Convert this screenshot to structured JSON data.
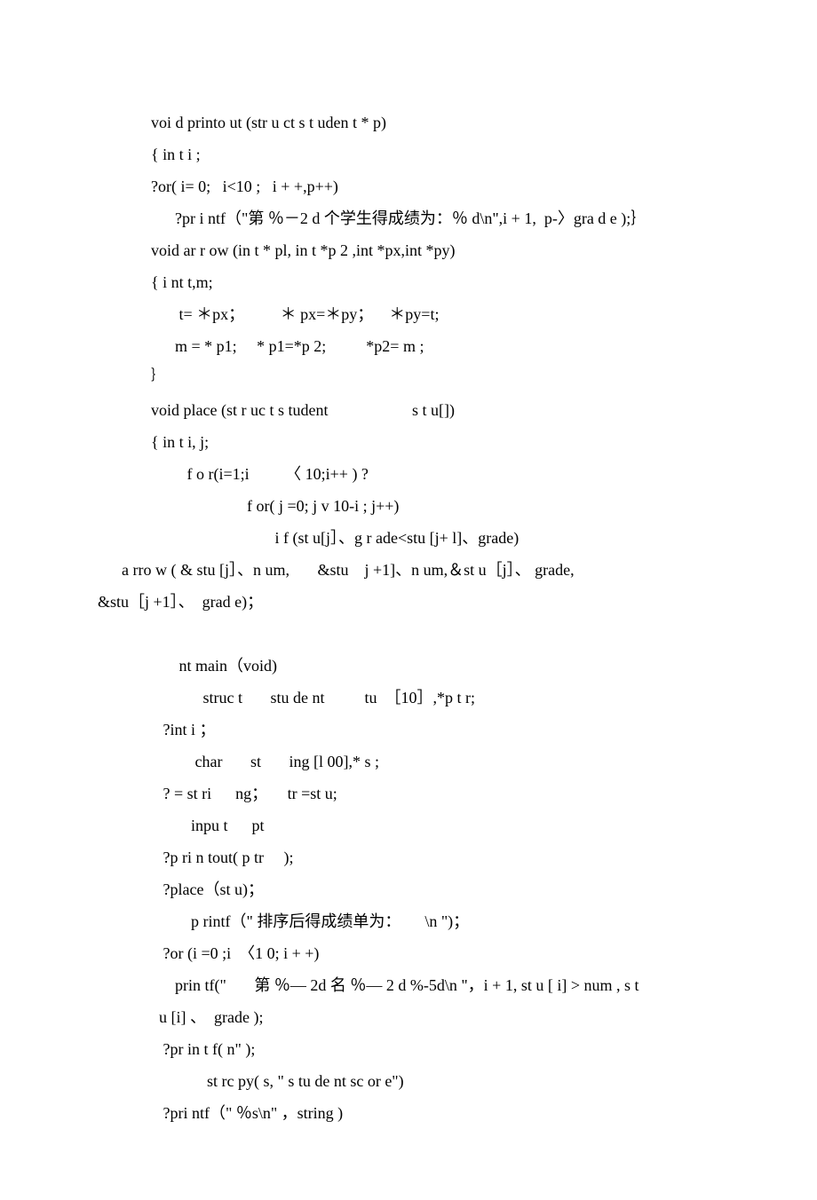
{
  "lines": [
    "voi d printo ut (str u ct s t uden t * p)",
    "{ in t i ;",
    "?or( i= 0;   i<10 ;   i + +,p++)",
    "      ?pr i ntf（\"第 ％－2 d 个学生得成绩为：％ d\\n\",i + 1,  p-〉gra d e );｝",
    "void ar r ow (in t * pl, in t *p 2 ,int *px,int *py)",
    "{ i nt t,m;",
    "       t= ＊px；         ＊ px=＊py；    ＊py=t;",
    "      m = * p1;     * p1=*p 2;          *p2= m ;",
    "｝",
    "void place (st r uc t s tudent                     s t u[])",
    "{ in t i, j;",
    "         f o r(i=1;i         〈 10;i++ ) ?",
    "                        f or( j =0; j v 10-i ; j++)",
    "                               i f (st u[j］、g r ade<stu [j+ l]、grade)",
    "      a rro w ( & stu [j］、n um,       &stu    j +1]、n um,＆st u［j］、 grade,",
    "&stu［j +1］、  grad e)；",
    "",
    "       nt main（void)",
    "             struc t       stu de nt          tu  ［10］,*p t r;",
    "   ?int i ；",
    "           char       st       ing [l 00],* s ;",
    "   ? = st ri      ng；     tr =st u;",
    "          inpu t      pt",
    "   ?p ri n tout( p tr     );",
    "   ?place（st u)；",
    "          p rintf（\" 排序后得成绩单为：      \\n \")；",
    "   ?or (i =0 ;i  〈1 0; i + +)",
    "      prin tf(\"       第 ％— 2d 名 ％— 2 d %-5d\\n \"，i + 1, st u [ i] > num , s t",
    "  u [i] 、  grade );",
    "   ?pr in t f( n\" );",
    "              st rc py( s, \" s tu de nt sc or e\")",
    "   ?pri ntf（\" ％s\\n\" ，string )"
  ]
}
